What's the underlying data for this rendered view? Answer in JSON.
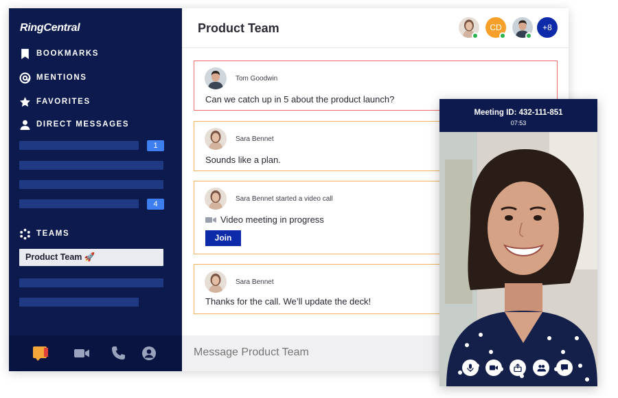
{
  "app": {
    "logo": "RingCentral"
  },
  "sidebar": {
    "nav": [
      {
        "label": "BOOKMARKS",
        "icon": "bookmark-icon"
      },
      {
        "label": "MENTIONS",
        "icon": "at-icon"
      },
      {
        "label": "FAVORITES",
        "icon": "star-icon"
      },
      {
        "label": "DIRECT MESSAGES",
        "icon": "person-icon"
      }
    ],
    "dm_badges": [
      "1",
      "4"
    ],
    "teams_label": "TEAMS",
    "active_team": "Product Team 🚀",
    "footer_icons": [
      "message-icon",
      "video-icon",
      "phone-icon",
      "contacts-icon"
    ]
  },
  "header": {
    "title": "Product Team",
    "avatar_initials": "CD",
    "more_count": "+8"
  },
  "messages": [
    {
      "author": "Tom Goodwin",
      "text": "Can we catch up in 5 about the product launch?"
    },
    {
      "author": "Sara Bennet",
      "text": "Sounds like a plan."
    },
    {
      "author": "Sara Bennet started a video call",
      "text": "Video meeting in progress",
      "button": "Join"
    },
    {
      "author": "Sara Bennet",
      "text": "Thanks for the call. We’ll update the deck!"
    }
  ],
  "compose": {
    "placeholder": "Message Product Team"
  },
  "video": {
    "meeting_id": "Meeting ID: 432-111-851",
    "time": "07:53",
    "controls": [
      "mic-icon",
      "camera-icon",
      "share-icon",
      "participants-icon",
      "chat-icon"
    ]
  },
  "colors": {
    "sidebar_bg": "#0c1a4d",
    "accent_blue": "#3d7ef0",
    "join_button": "#0d2aa9",
    "first_card_border": "#ef6b6b",
    "card_border": "#f0b25c",
    "online": "#2bb24c",
    "badge_cd": "#f6a02b"
  }
}
